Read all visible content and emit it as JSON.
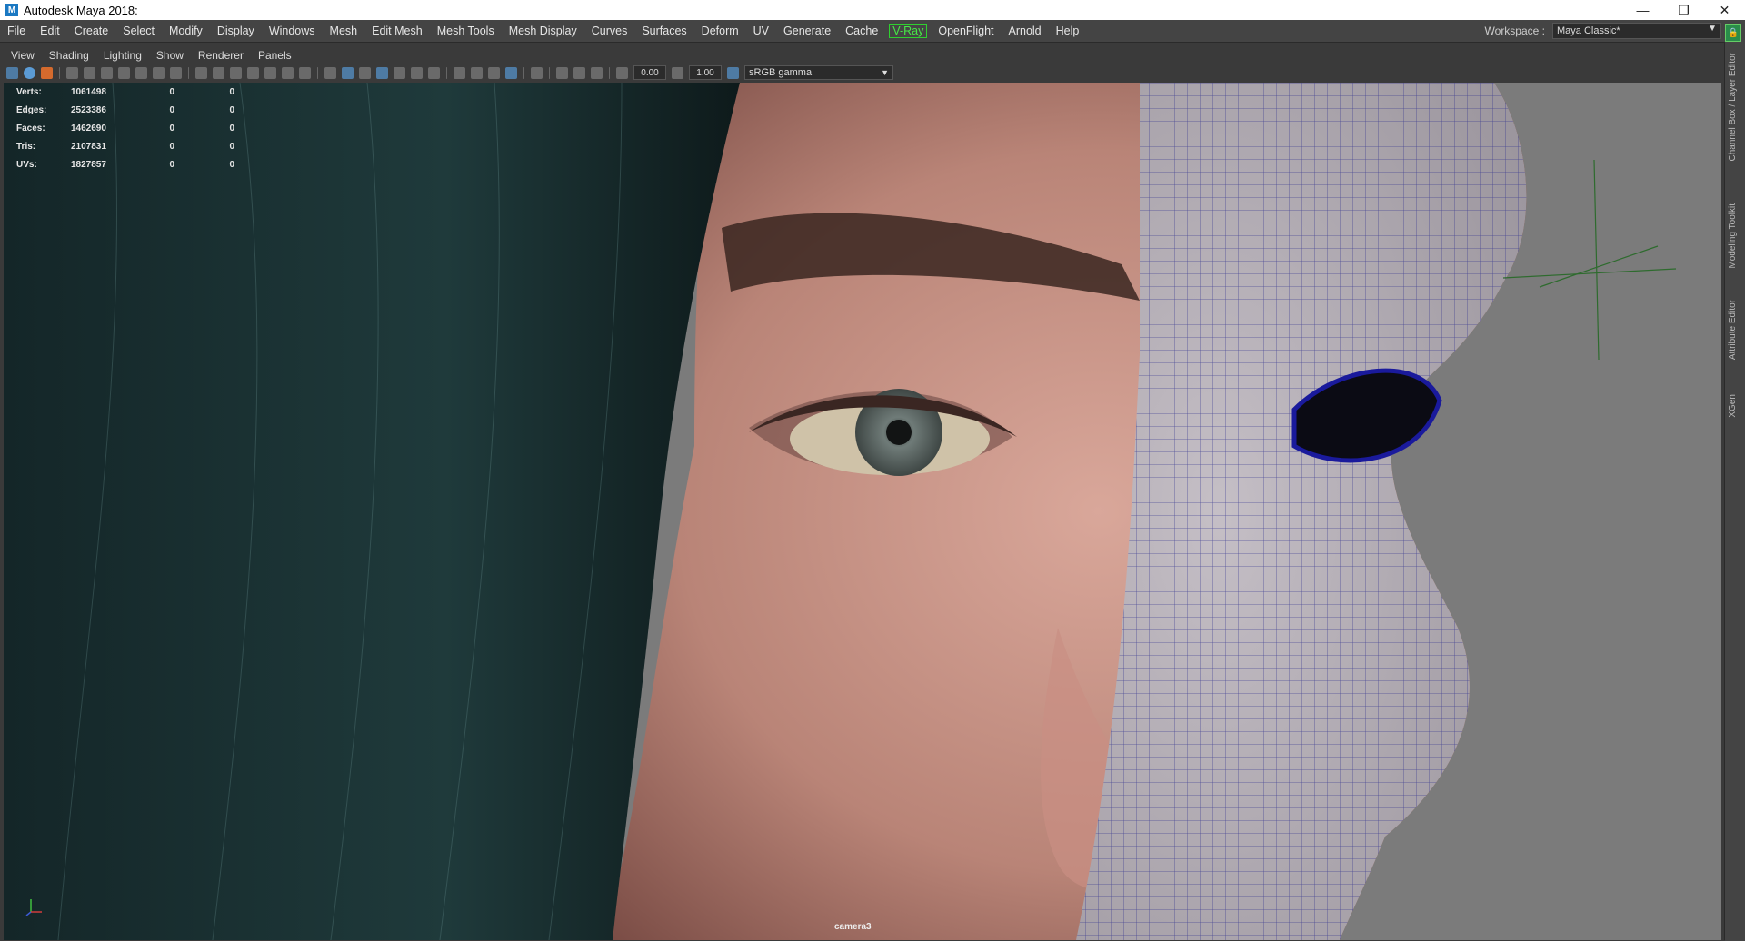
{
  "window": {
    "title": "Autodesk Maya 2018:",
    "icon": "maya-logo-icon",
    "controls": [
      "minimize-icon",
      "restore-icon",
      "close-icon"
    ]
  },
  "menubar": {
    "items": [
      "File",
      "Edit",
      "Create",
      "Select",
      "Modify",
      "Display",
      "Windows",
      "Mesh",
      "Edit Mesh",
      "Mesh Tools",
      "Mesh Display",
      "Curves",
      "Surfaces",
      "Deform",
      "UV",
      "Generate",
      "Cache",
      "V-Ray",
      "OpenFlight",
      "Arnold",
      "Help"
    ],
    "vray_accent": "#2fd02f"
  },
  "workspace": {
    "label": "Workspace :",
    "value": "Maya Classic*"
  },
  "panel_menu": {
    "items": [
      "View",
      "Shading",
      "Lighting",
      "Show",
      "Renderer",
      "Panels"
    ]
  },
  "panel_toolbar": {
    "exposure": "0.00",
    "gamma": "1.00",
    "color_space": "sRGB gamma"
  },
  "hud": {
    "rows": [
      {
        "label": "Verts:",
        "a": "1061498",
        "b": "0",
        "c": "0"
      },
      {
        "label": "Edges:",
        "a": "2523386",
        "b": "0",
        "c": "0"
      },
      {
        "label": "Faces:",
        "a": "1462690",
        "b": "0",
        "c": "0"
      },
      {
        "label": "Tris:",
        "a": "2107831",
        "b": "0",
        "c": "0"
      },
      {
        "label": "UVs:",
        "a": "1827857",
        "b": "0",
        "c": "0"
      }
    ]
  },
  "viewport": {
    "camera": "camera3",
    "wire_color": "#2a2a8c",
    "hair_color": "#1f3a3a",
    "skin_color": "#c9958a"
  },
  "sidebar": {
    "tabs": [
      "Channel Box / Layer Editor",
      "Modeling Toolkit",
      "Attribute Editor",
      "XGen"
    ]
  }
}
